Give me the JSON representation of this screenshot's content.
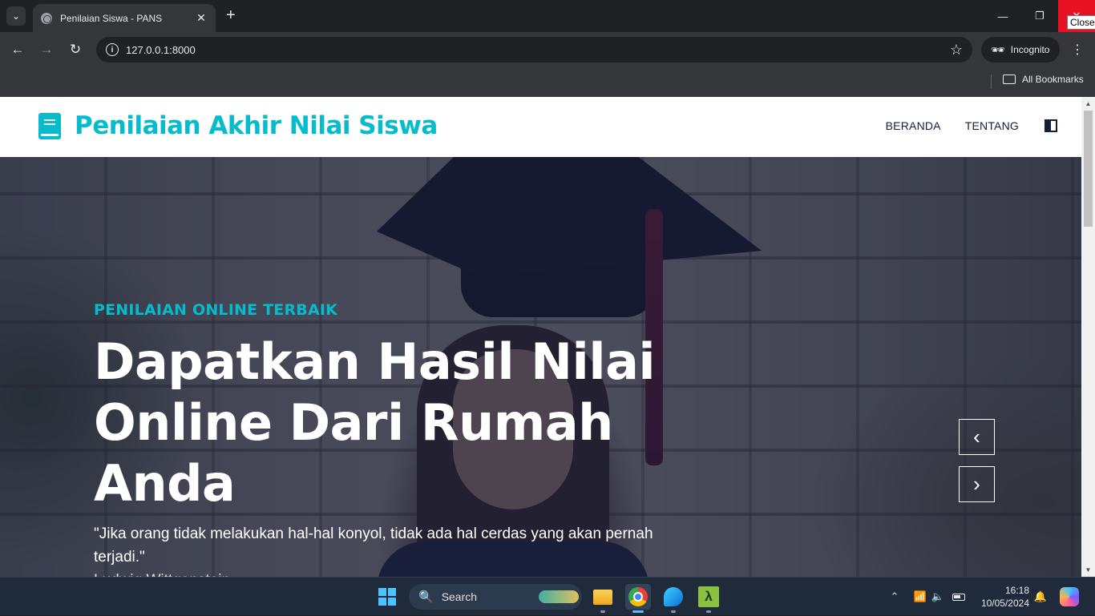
{
  "browser": {
    "tab_title": "Penilaian Siswa - PANS",
    "url": "127.0.0.1:8000",
    "incognito_label": "Incognito",
    "bookmarks_label": "All Bookmarks",
    "close_tooltip": "Close"
  },
  "site": {
    "brand": "Penilaian Akhir Nilai Siswa",
    "nav": [
      "BERANDA",
      "TENTANG"
    ],
    "accent_color": "#06bbcc",
    "dark_color": "#181d38"
  },
  "hero": {
    "eyebrow": "PENILAIAN ONLINE TERBAIK",
    "headline": "Dapatkan Hasil Nilai Online Dari Rumah Anda",
    "quote": "\"Jika orang tidak melakukan hal-hal konyol, tidak ada hal cerdas yang akan pernah terjadi.\"",
    "quote_author": "Ludwig Wittgenstein",
    "prev_icon": "chevron-left-icon",
    "next_icon": "chevron-right-icon"
  },
  "taskbar": {
    "search_placeholder": "Search",
    "time": "16:18",
    "date": "10/05/2024",
    "apps": [
      "file-explorer-icon",
      "chrome-icon",
      "edge-icon",
      "lambda-app-icon"
    ]
  }
}
